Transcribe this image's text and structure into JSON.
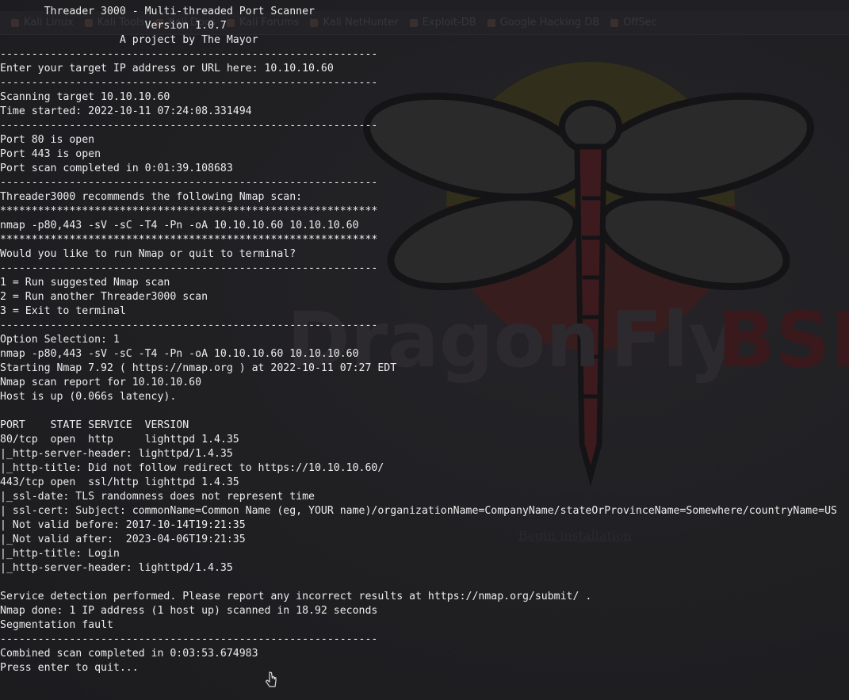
{
  "bookmarks": [
    {
      "label": "Kali Linux",
      "icon": "kali-icon"
    },
    {
      "label": "Kali Tools",
      "icon": "kali-tools-icon"
    },
    {
      "label": "Kali Docs",
      "icon": "kali-docs-icon"
    },
    {
      "label": "Kali Forums",
      "icon": "kali-forums-icon"
    },
    {
      "label": "Kali NetHunter",
      "icon": "nethunter-icon"
    },
    {
      "label": "Exploit-DB",
      "icon": "exploit-db-icon"
    },
    {
      "label": "Google Hacking DB",
      "icon": "ghdb-icon"
    },
    {
      "label": "OffSec",
      "icon": "offsec-icon"
    }
  ],
  "wallpaper": {
    "logo_word_1": "Dragon",
    "logo_word_2": "Fly",
    "logo_word_3": "BSD",
    "begin_link": "Begin installation",
    "colors": {
      "red": "#3d1a1e",
      "yellow": "#3a3419",
      "outline": "#141416",
      "text": "#2d2b2f"
    }
  },
  "terminal": {
    "lines": [
      "       Threader 3000 - Multi-threaded Port Scanner",
      "                       Version 1.0.7",
      "                   A project by The Mayor",
      "------------------------------------------------------------",
      "Enter your target IP address or URL here: 10.10.10.60",
      "------------------------------------------------------------",
      "Scanning target 10.10.10.60",
      "Time started: 2022-10-11 07:24:08.331494",
      "------------------------------------------------------------",
      "Port 80 is open",
      "Port 443 is open",
      "Port scan completed in 0:01:39.108683",
      "------------------------------------------------------------",
      "Threader3000 recommends the following Nmap scan:",
      "************************************************************",
      "nmap -p80,443 -sV -sC -T4 -Pn -oA 10.10.10.60 10.10.10.60",
      "************************************************************",
      "Would you like to run Nmap or quit to terminal?",
      "------------------------------------------------------------",
      "1 = Run suggested Nmap scan",
      "2 = Run another Threader3000 scan",
      "3 = Exit to terminal",
      "------------------------------------------------------------",
      "Option Selection: 1",
      "nmap -p80,443 -sV -sC -T4 -Pn -oA 10.10.10.60 10.10.10.60",
      "Starting Nmap 7.92 ( https://nmap.org ) at 2022-10-11 07:27 EDT",
      "Nmap scan report for 10.10.10.60",
      "Host is up (0.066s latency).",
      "",
      "PORT    STATE SERVICE  VERSION",
      "80/tcp  open  http     lighttpd 1.4.35",
      "|_http-server-header: lighttpd/1.4.35",
      "|_http-title: Did not follow redirect to https://10.10.10.60/",
      "443/tcp open  ssl/http lighttpd 1.4.35",
      "|_ssl-date: TLS randomness does not represent time",
      "| ssl-cert: Subject: commonName=Common Name (eg, YOUR name)/organizationName=CompanyName/stateOrProvinceName=Somewhere/countryName=US",
      "| Not valid before: 2017-10-14T19:21:35",
      "|_Not valid after:  2023-04-06T19:21:35",
      "|_http-title: Login",
      "|_http-server-header: lighttpd/1.4.35",
      "",
      "Service detection performed. Please report any incorrect results at https://nmap.org/submit/ .",
      "Nmap done: 1 IP address (1 host up) scanned in 18.92 seconds",
      "Segmentation fault",
      "------------------------------------------------------------",
      "Combined scan completed in 0:03:53.674983",
      "Press enter to quit..."
    ]
  }
}
